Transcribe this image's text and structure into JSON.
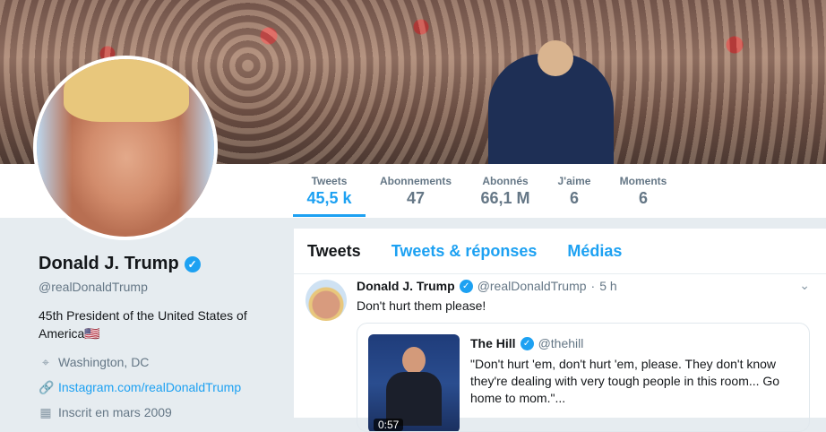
{
  "stats": [
    {
      "label": "Tweets",
      "value": "45,5 k",
      "active": true
    },
    {
      "label": "Abonnements",
      "value": "47"
    },
    {
      "label": "Abonnés",
      "value": "66,1 M"
    },
    {
      "label": "J'aime",
      "value": "6"
    },
    {
      "label": "Moments",
      "value": "6"
    }
  ],
  "profile": {
    "name": "Donald J. Trump",
    "handle": "@realDonaldTrump",
    "bio": "45th President of the United States of America",
    "flag": "🇺🇸",
    "location": "Washington, DC",
    "website": "Instagram.com/realDonaldTrump",
    "joined": "Inscrit en mars 2009"
  },
  "tabs": [
    "Tweets",
    "Tweets & réponses",
    "Médias"
  ],
  "tweet": {
    "name": "Donald J. Trump",
    "handle": "@realDonaldTrump",
    "time": "5 h",
    "separator": "·",
    "text": "Don't hurt them please!",
    "quote": {
      "name": "The Hill",
      "handle": "@thehill",
      "text": "\"Don't hurt 'em, don't hurt 'em, please. They don't know they're dealing with very tough people in this room... Go home to mom.\"...",
      "duration": "0:57"
    }
  },
  "colors": {
    "accent": "#1da1f2",
    "text": "#14171a",
    "muted": "#657786"
  },
  "icons": [
    "verified-badge-icon",
    "location-pin-icon",
    "link-icon",
    "calendar-icon",
    "chevron-down-icon"
  ]
}
